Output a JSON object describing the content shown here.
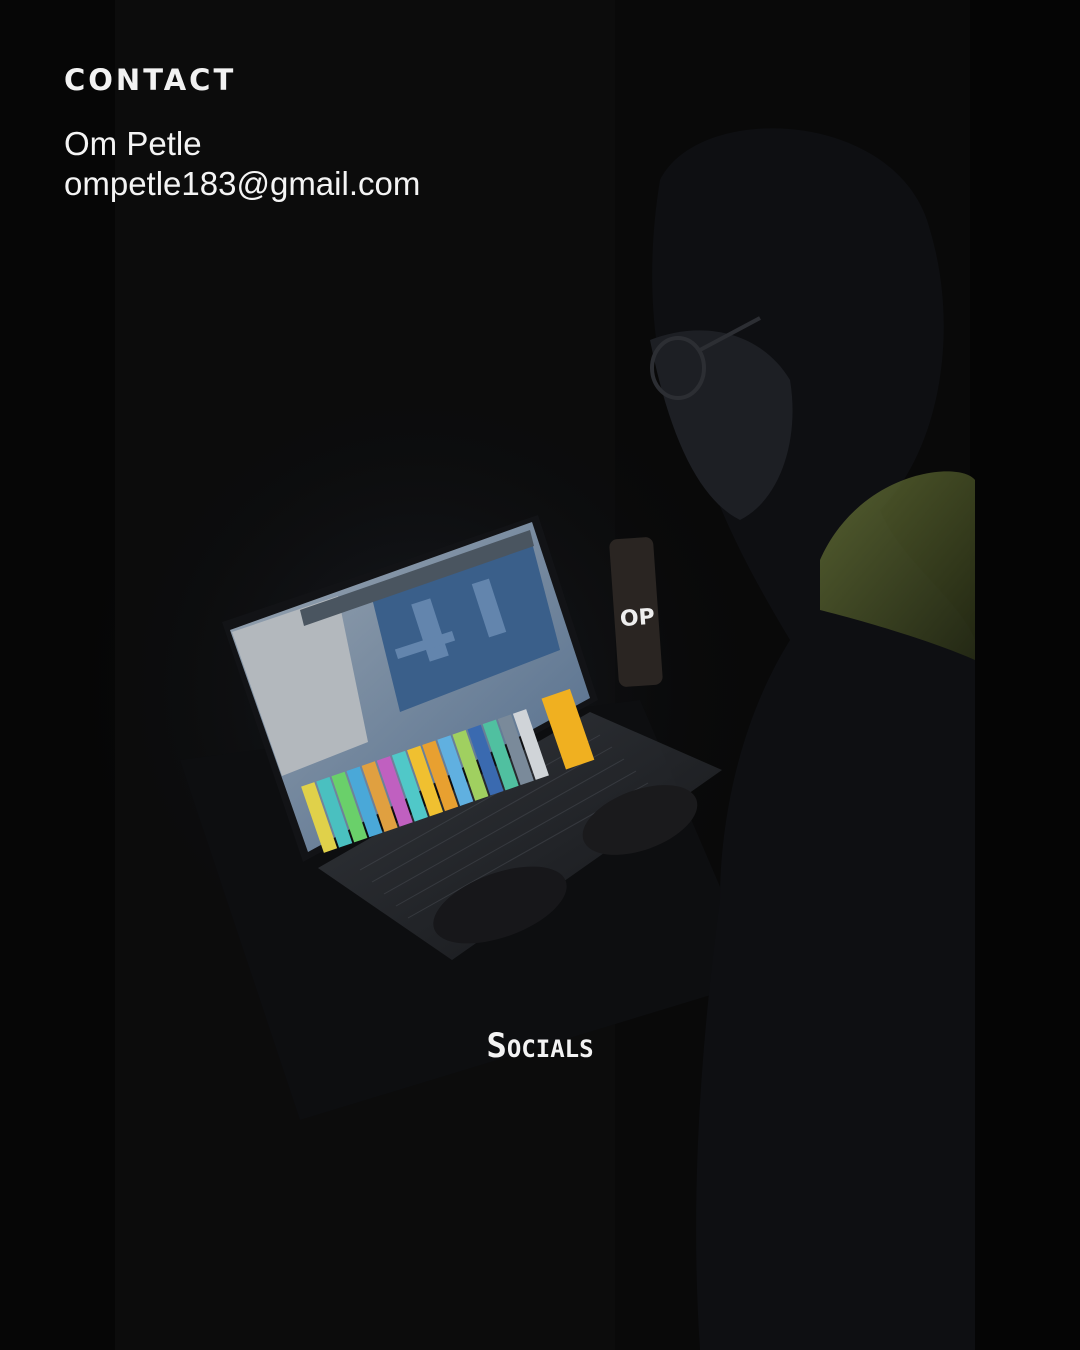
{
  "contact": {
    "heading": "CONTACT",
    "name": "Om Petle",
    "email": "ompetle183@gmail.com"
  },
  "socials": {
    "label": "Socials"
  },
  "colors": {
    "background": "#060606",
    "text": "#f2f2f2"
  },
  "photo": {
    "subject": "person-producing-music-on-laptop-in-dark-room",
    "phone_logo_text": "OP"
  }
}
